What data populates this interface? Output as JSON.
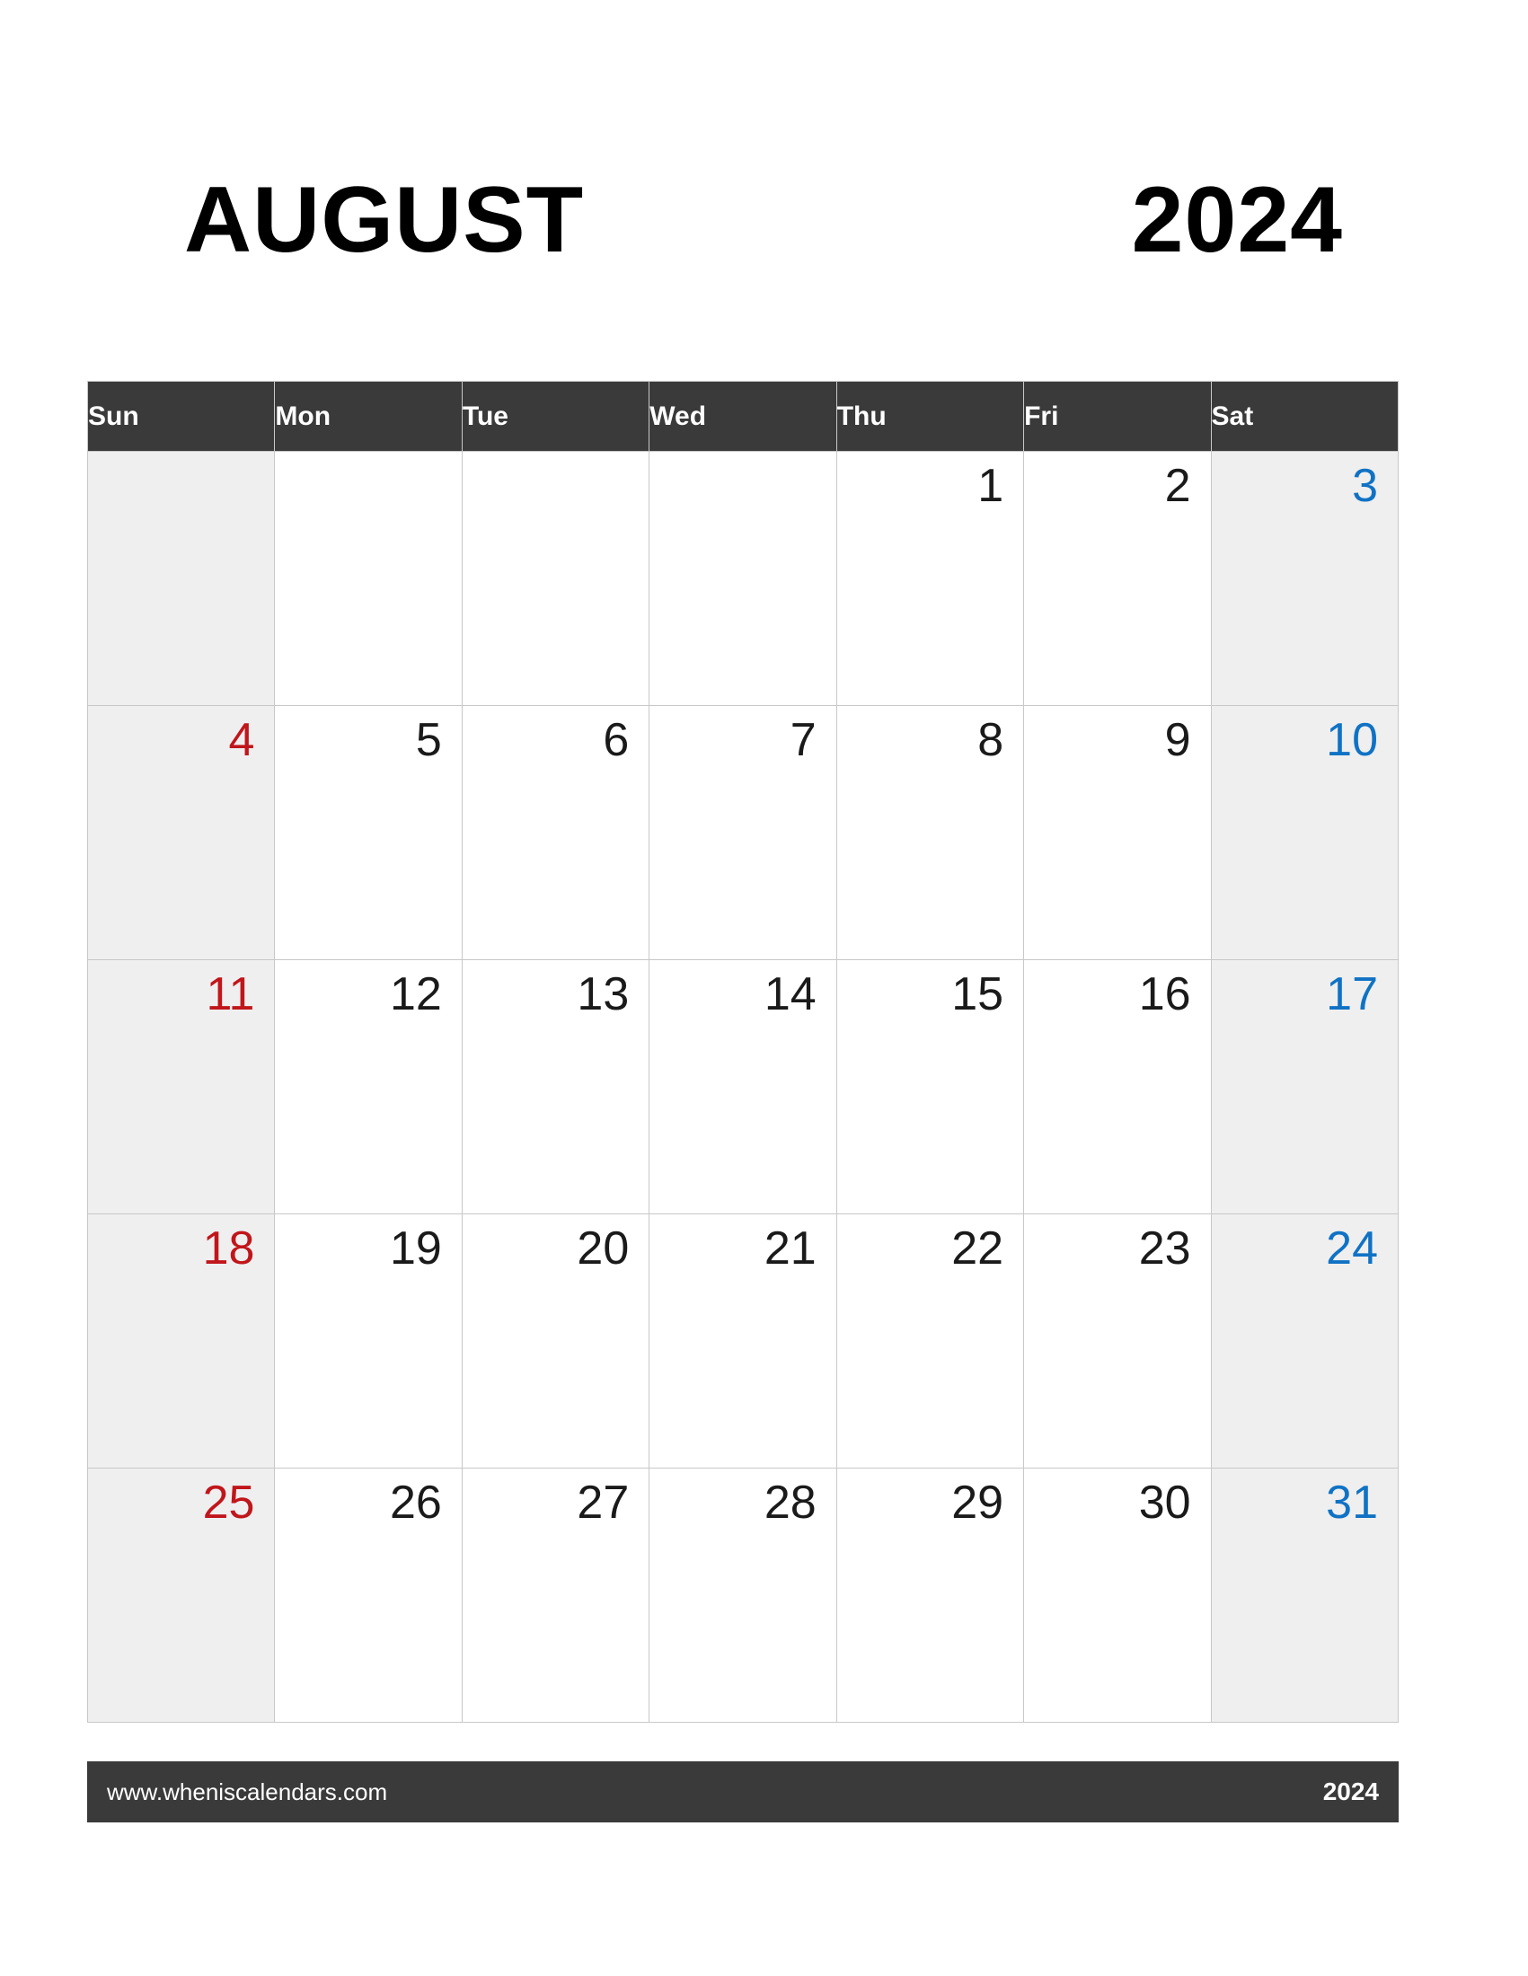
{
  "title": {
    "month": "AUGUST",
    "year": "2024"
  },
  "weekdays": [
    "Sun",
    "Mon",
    "Tue",
    "Wed",
    "Thu",
    "Fri",
    "Sat"
  ],
  "weeks": [
    [
      "",
      "",
      "",
      "",
      "1",
      "2",
      "3"
    ],
    [
      "4",
      "5",
      "6",
      "7",
      "8",
      "9",
      "10"
    ],
    [
      "11",
      "12",
      "13",
      "14",
      "15",
      "16",
      "17"
    ],
    [
      "18",
      "19",
      "20",
      "21",
      "22",
      "23",
      "24"
    ],
    [
      "25",
      "26",
      "27",
      "28",
      "29",
      "30",
      "31"
    ]
  ],
  "footer": {
    "site": "www.wheniscalendars.com",
    "year": "2024"
  },
  "colors": {
    "header_bg": "#3a3a3a",
    "weekend_bg": "#efefef",
    "sunday_text": "#c0161b",
    "saturday_text": "#1072c4",
    "weekday_text": "#1a1a1a",
    "grid_line": "#c8c8c8"
  }
}
